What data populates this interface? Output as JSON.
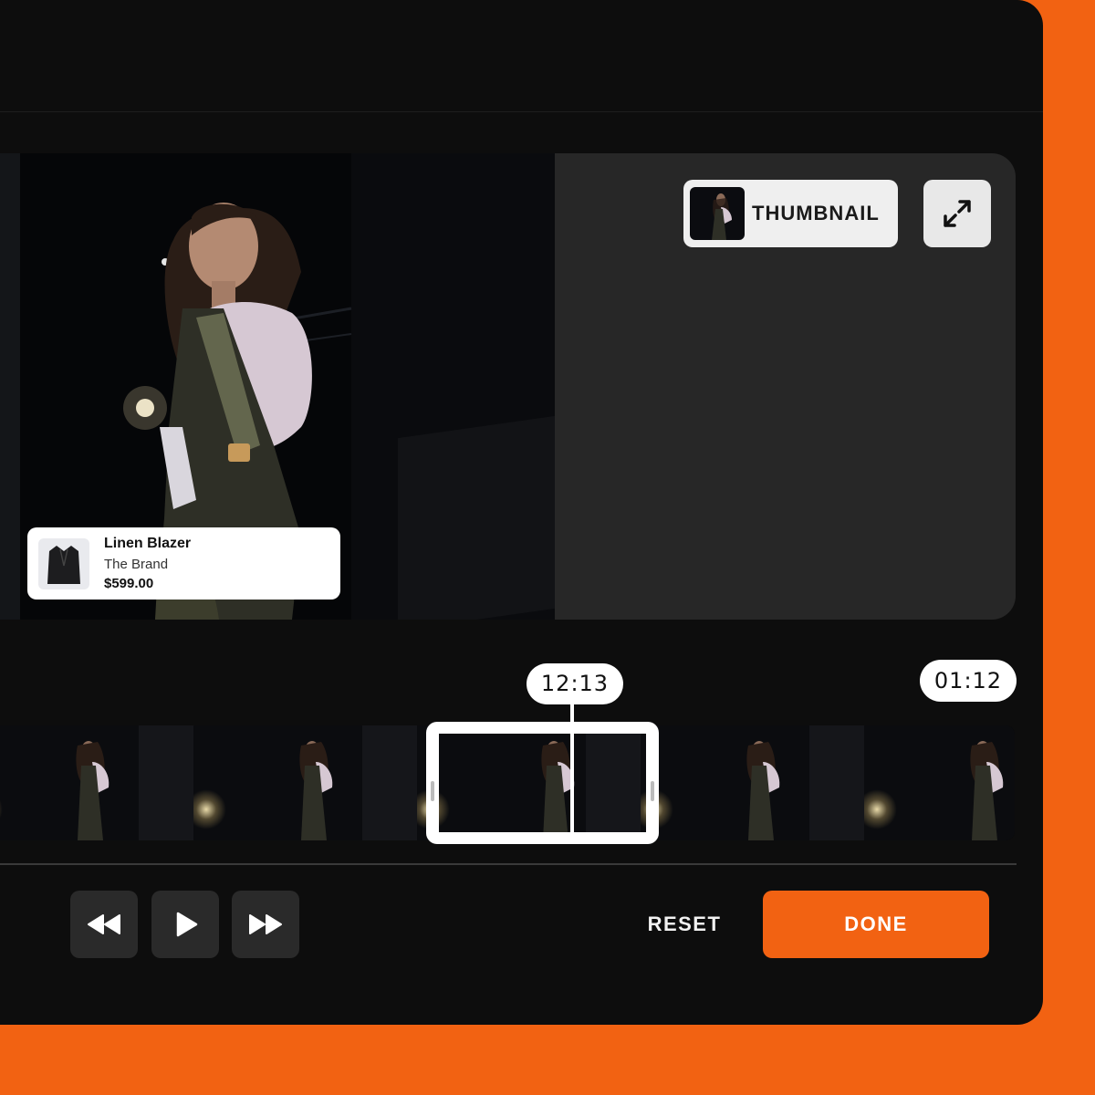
{
  "product": {
    "name": "Linen Blazer",
    "brand": "The Brand",
    "price": "$599.00"
  },
  "preview": {
    "thumbnail_label": "THUMBNAIL",
    "expand_icon": "expand-icon"
  },
  "timeline": {
    "current_time": "12:13",
    "total_time": "01:12",
    "frame_count": 5
  },
  "controls": {
    "rewind_icon": "rewind-icon",
    "play_icon": "play-icon",
    "forward_icon": "fast-forward-icon",
    "reset_label": "RESET",
    "done_label": "DONE"
  },
  "colors": {
    "accent": "#f26212",
    "panel": "#0d0d0d",
    "preview_bg": "#272727",
    "control_bg": "#2a2a2a"
  }
}
